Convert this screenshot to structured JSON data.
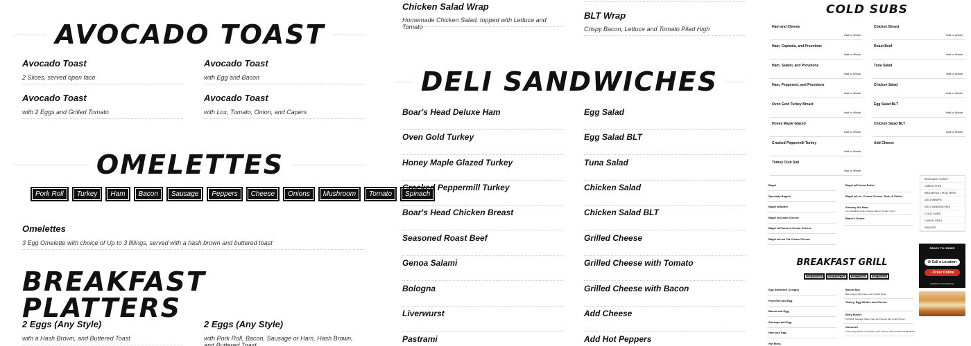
{
  "avocado": {
    "heading": "AVOCADO TOAST",
    "items": [
      {
        "name": "Avocado Toast",
        "desc": "2 Slices, served open face"
      },
      {
        "name": "Avocado Toast",
        "desc": "with Egg and Bacon"
      },
      {
        "name": "Avocado Toast",
        "desc": "with 2 Eggs and Grilled Tomato"
      },
      {
        "name": "Avocado Toast",
        "desc": "with Lox, Tomato, Onion, and Capers"
      }
    ]
  },
  "omelettes": {
    "heading": "OMELETTES",
    "tags": [
      "Pork Roll",
      "Turkey",
      "Ham",
      "Bacon",
      "Sausage",
      "Peppers",
      "Cheese",
      "Onions",
      "Mushroom",
      "Tomato",
      "Spinach"
    ],
    "item": {
      "name": "Omelettes",
      "desc": "3 Egg Omelette with choice of Up to 3 fillings, served with a hash brown and buttered toast"
    }
  },
  "platters": {
    "heading": "BREAKFAST PLATTERS",
    "items": [
      {
        "name": "2 Eggs (Any Style)",
        "desc": "with a Hash Brown, and Buttered Toast"
      },
      {
        "name": "2 Eggs (Any Style)",
        "desc": "with Pork Roll, Bacon, Sausage or Ham, Hash Brown, and Buttered Toast"
      }
    ]
  },
  "wraps": [
    {
      "name": "Chicken Salad Wrap",
      "desc": "Homemade Chicken Salad, topped with Lettuce and Tomato"
    },
    {
      "name": "BLT Wrap",
      "desc": "Crispy Bacon, Lettuce and Tomato Piled High"
    }
  ],
  "deli": {
    "heading": "DELI SANDWICHES",
    "left": [
      "Boar's Head Deluxe Ham",
      "Oven Gold Turkey",
      "Honey Maple Glazed Turkey",
      "Cracked Peppermill Turkey",
      "Boar's Head Chicken Breast",
      "Seasoned Roast Beef",
      "Genoa Salami",
      "Bologna",
      "Liverwurst",
      "Pastrami"
    ],
    "right": [
      "Egg Salad",
      "Egg Salad BLT",
      "Tuna Salad",
      "Chicken Salad",
      "Chicken Salad BLT",
      "Grilled Cheese",
      "Grilled Cheese with Tomato",
      "Grilled Cheese with Bacon",
      "Add Cheese",
      "Add Hot Peppers"
    ]
  },
  "cold_subs": {
    "heading": "COLD SUBS",
    "half_whole": "Half or Whole",
    "left": [
      "Ham and Cheese",
      "Ham, Capicola, and Provolone",
      "Ham, Salami, and Provolone",
      "Ham, Pepperoni, and Provolone",
      "Oven Gold Turkey Breast",
      "Honey Maple Glazed",
      "Cracked Peppermill Turkey",
      "Turkey Club Sub"
    ],
    "right": [
      "Chicken Breast",
      "Roast Beef",
      "Tuna Salad",
      "Chicken Salad",
      "Egg Salad BLT",
      "Chicken Salad BLT",
      "Add Cheese"
    ]
  },
  "bagels": {
    "left": [
      "Bagel",
      "Specialty Bagels",
      "Bagel w/Butter",
      "Bagel w/Cream Cheese",
      "Bagel w/Flavored Cream Cheese",
      "Bagel w/Low Fat Cream Cheese"
    ],
    "right": [
      {
        "name": "Bagel w/Peanut Butter",
        "desc": ""
      },
      {
        "name": "Bagel w/Lox, Cream Cheese, Side, & Pickle",
        "desc": ""
      },
      {
        "name": "Smokey the Bear",
        "desc": "Lox w/Scallion Cream Cheese, Bacon, Tomato, Onion"
      },
      {
        "name": "Baker's Dozen",
        "desc": ""
      }
    ]
  },
  "sidebar": {
    "items": [
      "AVOCADO TOAST",
      "OMELETTES",
      "BREAKFAST PLATTERS",
      "DELI WRAPS",
      "DELI SANDWICHES",
      "COLD SUBS",
      "LUNCH GRILL",
      "SNACKS"
    ]
  },
  "order": {
    "title": "READY TO ORDER",
    "call": "Call a Location",
    "online": "Order Online",
    "powered": "ORDER ON DOORDASH"
  },
  "grill": {
    "heading": "BREAKFAST GRILL",
    "tags": [
      "Add Avocado",
      "Add Extra Egg",
      "Add Cheese",
      "Add Tomato"
    ],
    "left": [
      "Egg Sandwich (2 eggs)",
      "Pork Roll and Egg",
      "Bacon and Egg",
      "Sausage and Egg",
      "Ham and Egg",
      "Hot Mess"
    ],
    "right": [
      {
        "name": "Bacon Boy",
        "desc": "Bacon, Egg, and Cheese with a Hash Brown"
      },
      {
        "name": "Turkey, Egg Whites and Cheese",
        "desc": ""
      },
      {
        "name": "Belly Buster",
        "desc": "Pork Roll, Sausage, Bacon, Egg and Cheese with a Hash Brown"
      },
      {
        "name": "Gammich",
        "desc": "Turkey, Egg Whites, and Pepper Jack Cheese, with avocado and jalapeños"
      }
    ]
  },
  "colors": {
    "dark": "#111111",
    "accent": "#d32f1f",
    "white": "#ffffff"
  }
}
